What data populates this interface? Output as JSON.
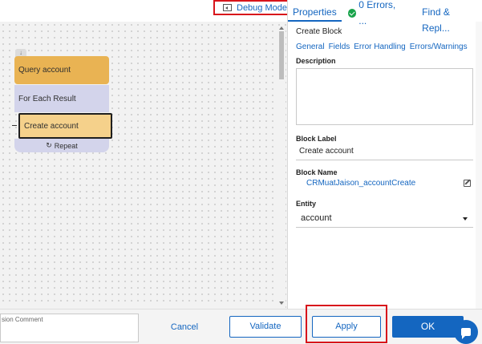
{
  "topbar": {
    "debug_label": "Debug Mode"
  },
  "panel": {
    "tabs": [
      {
        "label": "Properties"
      },
      {
        "label": "0 Errors, ..."
      },
      {
        "label": "Find & Repl..."
      }
    ],
    "title": "Create Block",
    "sublinks": [
      "General",
      "Fields",
      "Error Handling",
      "Errors/Warnings"
    ],
    "description": {
      "label": "Description",
      "value": ""
    },
    "block_label": {
      "label": "Block Label",
      "value": "Create account"
    },
    "block_name": {
      "label": "Block Name",
      "value": "CRMuatJaison_accountCreate"
    },
    "entity": {
      "label": "Entity",
      "value": "account"
    }
  },
  "canvas": {
    "blocks": [
      {
        "label": "Query account"
      },
      {
        "label": "For Each Result"
      },
      {
        "label": "Create account"
      },
      {
        "label": "Repeat"
      }
    ]
  },
  "footer": {
    "comment_placeholder": "sion Comment",
    "cancel": "Cancel",
    "validate": "Validate",
    "apply": "Apply",
    "ok": "OK"
  },
  "colors": {
    "accent": "#1466c0",
    "highlight": "#d8141b",
    "query_block": "#e9b353",
    "foreach_block": "#d3d4eb",
    "create_block": "#f5d18b"
  }
}
